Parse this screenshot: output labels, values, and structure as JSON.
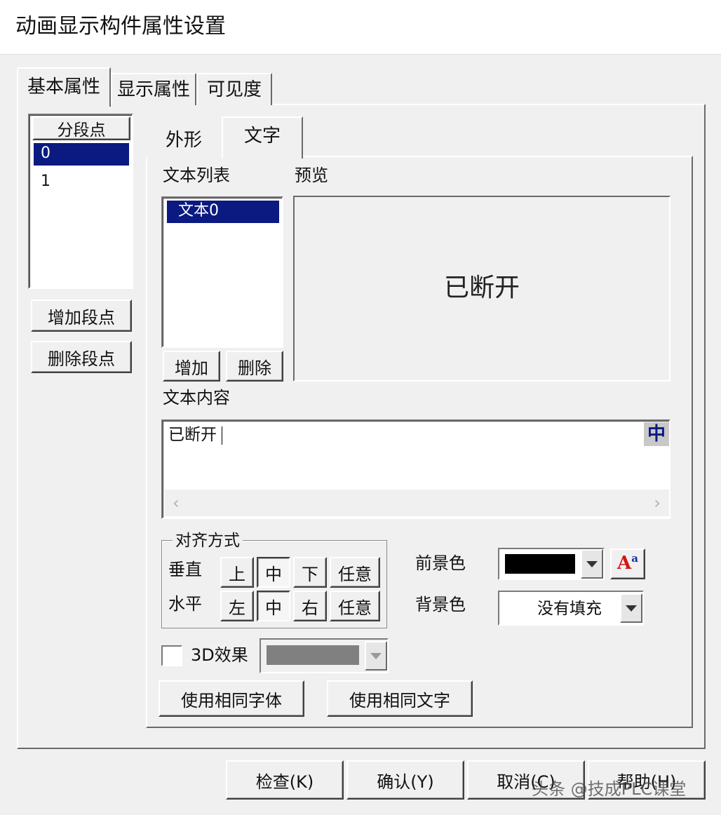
{
  "window": {
    "title": "动画显示构件属性设置"
  },
  "tabs": [
    "基本属性",
    "显示属性",
    "可见度"
  ],
  "segments": {
    "header": "分段点",
    "items": [
      "0",
      "1"
    ],
    "add_label": "增加段点",
    "delete_label": "删除段点"
  },
  "subtabs": [
    "外形",
    "文字"
  ],
  "text_list": {
    "label": "文本列表",
    "items": [
      "文本0"
    ],
    "add_label": "增加",
    "delete_label": "删除"
  },
  "preview": {
    "label": "预览",
    "text": "已断开"
  },
  "content": {
    "label": "文本内容",
    "value": "已断开",
    "ime_icon": "中"
  },
  "align": {
    "group_label": "对齐方式",
    "vertical_label": "垂直",
    "horizontal_label": "水平",
    "vertical_options": [
      "上",
      "中",
      "下",
      "任意"
    ],
    "horizontal_options": [
      "左",
      "中",
      "右",
      "任意"
    ],
    "vertical_selected": "中",
    "horizontal_selected": "中"
  },
  "colors": {
    "fg_label": "前景色",
    "bg_label": "背景色",
    "fg_value": "#000000",
    "bg_value": "没有填充",
    "font_icon": "font-color-icon"
  },
  "effect3d": {
    "label": "3D效果",
    "checked": false
  },
  "same_font_label": "使用相同字体",
  "same_text_label": "使用相同文字",
  "footer": {
    "check_label": "检查(K)",
    "ok_label": "确认(Y)",
    "cancel_label": "取消(C)",
    "help_label": "帮助(H)"
  },
  "watermark": "头条 @技成PLC课堂"
}
